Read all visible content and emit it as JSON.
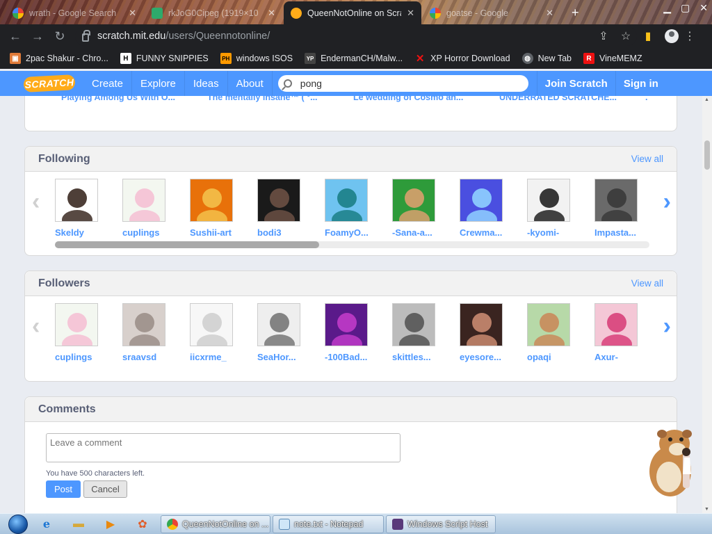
{
  "browser": {
    "tabs": [
      {
        "title": "wrath - Google Search",
        "favicon": "google-icon",
        "active": false
      },
      {
        "title": "rkJoG0Cipeg (1919×10",
        "favicon": "image-icon",
        "active": false
      },
      {
        "title": "QueenNotOnline on Scra",
        "favicon": "scratch-icon",
        "active": true
      },
      {
        "title": "goatse - Google",
        "favicon": "google-icon",
        "active": false
      }
    ],
    "url_host": "scratch.mit.edu",
    "url_path": "/users/Queennotonline/",
    "bookmarks": [
      {
        "label": "2pac Shakur - Chro...",
        "icon": "bookmark-icon",
        "color": "#e07b39"
      },
      {
        "label": "FUNNY SNIPPIES",
        "icon": "letter-h-icon",
        "color": "#ffffff"
      },
      {
        "label": "windows ISOS",
        "icon": "ph-icon",
        "color": "#f90"
      },
      {
        "label": "EndermanCH/Malw...",
        "icon": "yp-icon",
        "color": "#333"
      },
      {
        "label": "XP Horror Download",
        "icon": "x-icon",
        "color": "#e11"
      },
      {
        "label": "New Tab",
        "icon": "globe-icon",
        "color": "#5f6368"
      },
      {
        "label": "VineMEMZ",
        "icon": "r-icon",
        "color": "#e11"
      }
    ]
  },
  "scratch_nav": {
    "logo": "SCRATCH",
    "items": [
      "Create",
      "Explore",
      "Ideas",
      "About"
    ],
    "search_value": "pong",
    "join": "Join Scratch",
    "signin": "Sign in"
  },
  "projects_row": [
    "Playing Among Us With O...",
    "The mëntally insãne™ ( ͡°...",
    "Le wedding of Cosmo an...",
    "UNDERRATED SCRATCHE...",
    "."
  ],
  "following": {
    "title": "Following",
    "view_all": "View all",
    "users": [
      {
        "name": "Skeldy",
        "bg": "#ffffff",
        "fg": "#3b2a22"
      },
      {
        "name": "cuplings",
        "bg": "#f3f7f0",
        "fg": "#f5c0d4"
      },
      {
        "name": "Sushii-art",
        "bg": "#e8710a",
        "fg": "#f3c04a"
      },
      {
        "name": "bodi3",
        "bg": "#1a1a1a",
        "fg": "#6b5044"
      },
      {
        "name": "FoamyO...",
        "bg": "#6fc3f0",
        "fg": "#1b7f86"
      },
      {
        "name": "-Sana-a...",
        "bg": "#2e9b3a",
        "fg": "#d9a06e"
      },
      {
        "name": "Crewma...",
        "bg": "#4a4fe0",
        "fg": "#8fd0ff"
      },
      {
        "name": "-kyomi-",
        "bg": "#f2f2f2",
        "fg": "#222222"
      },
      {
        "name": "Impasta...",
        "bg": "#6a6a6a",
        "fg": "#3a3a3a"
      }
    ]
  },
  "followers": {
    "title": "Followers",
    "view_all": "View all",
    "users": [
      {
        "name": "cuplings",
        "bg": "#f3f7f0",
        "fg": "#f5c0d4"
      },
      {
        "name": "sraavsd",
        "bg": "#d8d0cc",
        "fg": "#9c8f8a"
      },
      {
        "name": "iicxrme_",
        "bg": "#f7f7f7",
        "fg": "#cfcfcf"
      },
      {
        "name": "SeaHor...",
        "bg": "#eeeeee",
        "fg": "#777777"
      },
      {
        "name": "-100Bad...",
        "bg": "#5a1a8a",
        "fg": "#c03bc8"
      },
      {
        "name": "skittles...",
        "bg": "#bcbcbc",
        "fg": "#555555"
      },
      {
        "name": "eyesore...",
        "bg": "#3a2420",
        "fg": "#c98a70"
      },
      {
        "name": "opaqi",
        "bg": "#b7d9a8",
        "fg": "#c98a5a"
      },
      {
        "name": "Axur-",
        "bg": "#f4c7d6",
        "fg": "#d8407a"
      }
    ]
  },
  "comments": {
    "title": "Comments",
    "placeholder": "Leave a comment",
    "chars_left": "You have 500 characters left.",
    "post": "Post",
    "cancel": "Cancel"
  },
  "taskbar": {
    "tasks": [
      {
        "label": "QueenNotOnline on ...",
        "icon": "chrome-icon"
      },
      {
        "label": "note.txt - Notepad",
        "icon": "notepad-icon"
      },
      {
        "label": "Windows Script Host",
        "icon": "script-host-icon"
      }
    ]
  },
  "colors": {
    "scratch_blue": "#4d97ff",
    "scratch_orange": "#ffab19",
    "chrome_dark": "#202124"
  }
}
